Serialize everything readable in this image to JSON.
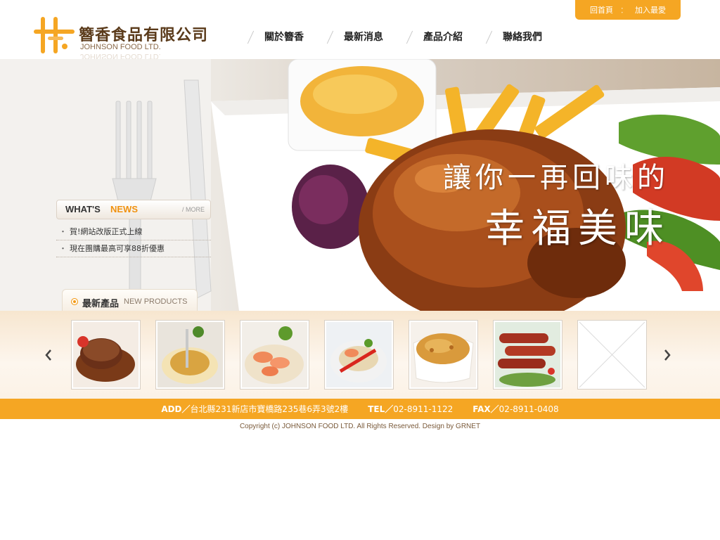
{
  "brand": {
    "name": "簪香食品有限公司",
    "name_en": "JOHNSON FOOD LTD.",
    "logo_color": "#f5a623"
  },
  "topbar": {
    "home": "回首頁",
    "separator": "：",
    "favorite": "加入最愛"
  },
  "nav": {
    "items": [
      {
        "label": "關於簪香"
      },
      {
        "label": "最新消息"
      },
      {
        "label": "產品介紹"
      },
      {
        "label": "聯絡我們"
      }
    ]
  },
  "banner": {
    "slogan_line1": "讓你一再回味的",
    "slogan_line2": "幸福美味"
  },
  "news": {
    "title_what": "WHAT'S",
    "title_news": "NEWS",
    "more": "/ MORE",
    "items": [
      {
        "bullet": "・",
        "text": "賀!網站改版正式上線"
      },
      {
        "bullet": "・",
        "text": "現在團購最高可享88折優惠"
      }
    ]
  },
  "products": {
    "tab_zh": "最新產品",
    "tab_en": "NEW PRODUCTS",
    "thumbs": [
      {
        "icon": "steak-image"
      },
      {
        "icon": "pasta-image"
      },
      {
        "icon": "shrimp-rice-image"
      },
      {
        "icon": "shrimp-salad-image"
      },
      {
        "icon": "gratin-image"
      },
      {
        "icon": "sausage-image"
      },
      {
        "icon": "placeholder-image"
      }
    ],
    "prev_icon": "chevron-left-icon",
    "next_icon": "chevron-right-icon"
  },
  "footer": {
    "add_label": "ADD／",
    "address": "台北縣231新店市寶橋路235巷6弄3號2樓",
    "tel_label": "TEL／",
    "tel": "02-8911-1122",
    "fax_label": "FAX／",
    "fax": "02-8911-0408",
    "copyright": "Copyright (c) JOHNSON FOOD LTD. All Rights Reserved. Design by GRNET"
  },
  "colors": {
    "accent": "#f5a623",
    "brand_text": "#5a3a1a",
    "news_accent": "#f0910e"
  }
}
